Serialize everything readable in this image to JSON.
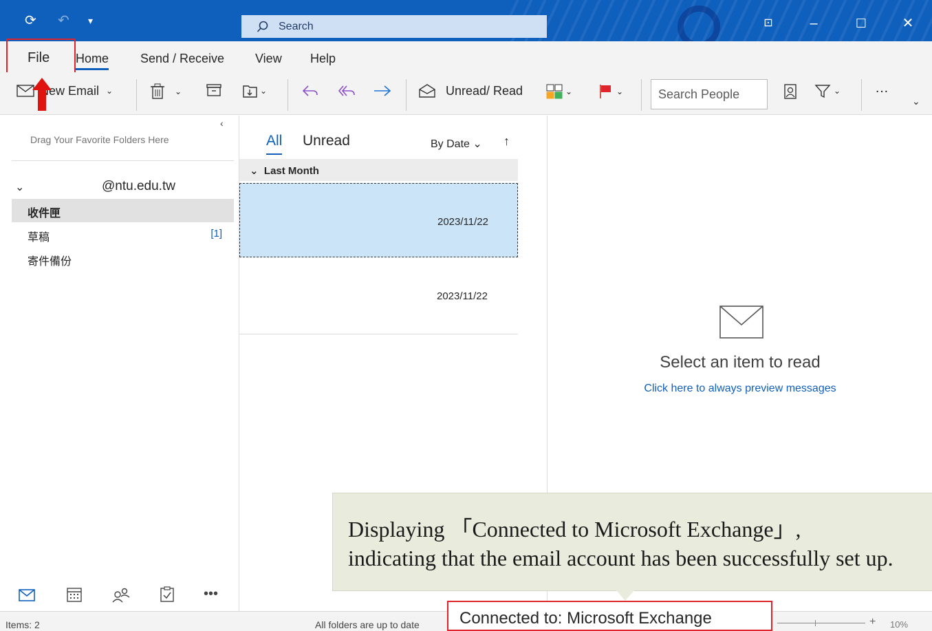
{
  "titlebar": {
    "search_placeholder": "Search"
  },
  "menu": {
    "file": "File",
    "home": "Home",
    "send_receive": "Send / Receive",
    "view": "View",
    "help": "Help"
  },
  "ribbon": {
    "new_email": "New Email",
    "unread_read": "Unread/ Read",
    "search_people": "Search People",
    "more": "…"
  },
  "folderpane": {
    "favorites_hint": "Drag Your Favorite Folders Here",
    "account": "@ntu.edu.tw",
    "folders": [
      {
        "label": "收件匣",
        "count": ""
      },
      {
        "label": "草稿",
        "count": "[1]"
      },
      {
        "label": "寄件備份",
        "count": ""
      }
    ]
  },
  "messagelist": {
    "tab_all": "All",
    "tab_unread": "Unread",
    "sort_label": "By Date",
    "group": "Last Month",
    "messages": [
      {
        "date": "2023/11/22"
      },
      {
        "date": "2023/11/22"
      }
    ]
  },
  "reading": {
    "title": "Select an item to read",
    "link": "Click here to always preview messages"
  },
  "statusbar": {
    "items": "Items: 2",
    "up_to_date": "All folders are up to date",
    "connected": "Connected to: Microsoft Exchange",
    "zoom": "10%"
  },
  "callout": {
    "line1": "Displaying 「Connected to Microsoft Exchange」,",
    "line2": "indicating that the email account has been successfully set up."
  },
  "colors": {
    "accent": "#0f5fbd",
    "highlight_red": "#e0242b",
    "selected_row": "#cce4f7",
    "callout_bg": "#e9ecdc"
  }
}
